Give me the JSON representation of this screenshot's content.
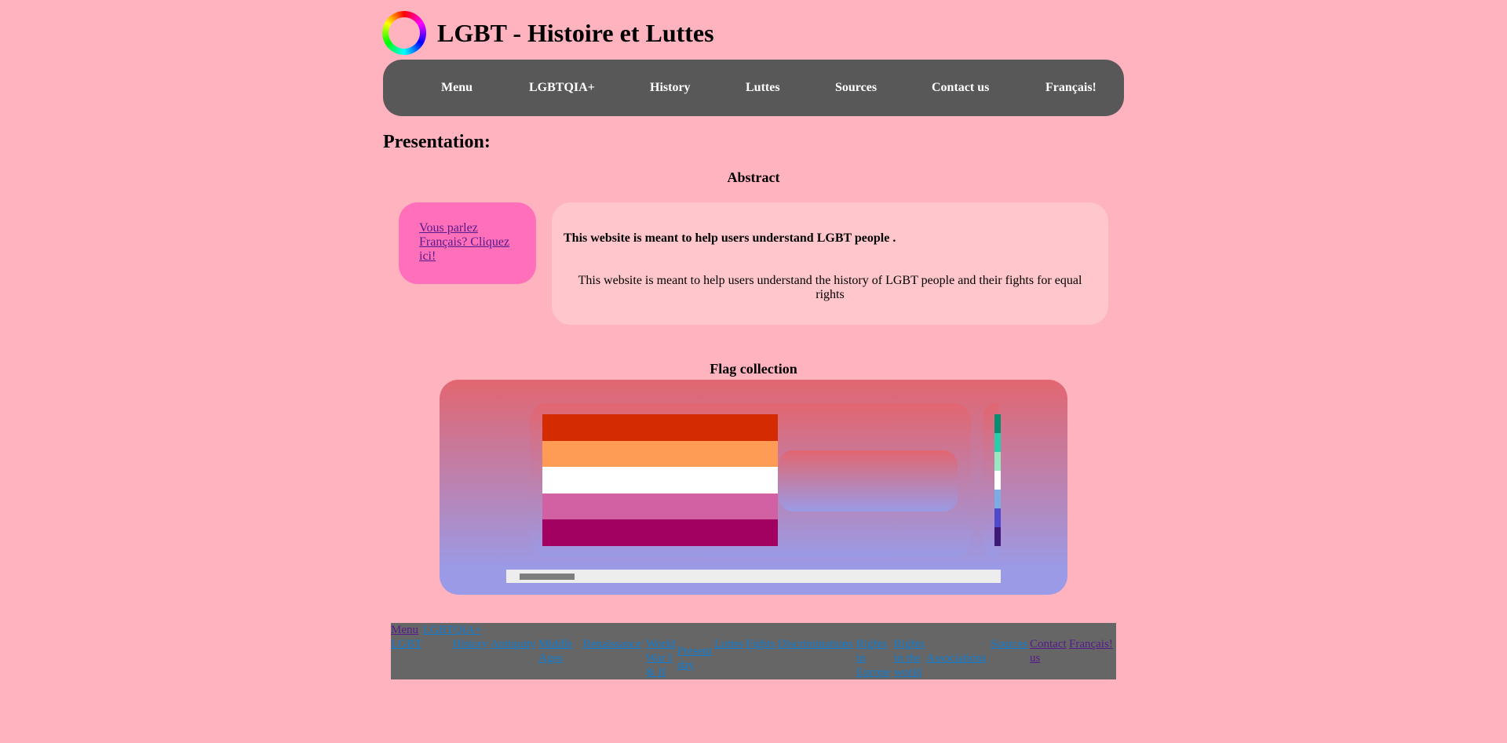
{
  "header": {
    "title": "LGBT - Histoire et Luttes",
    "logo_icon": "rainbow-ring-icon"
  },
  "nav": [
    "Menu",
    "LGBTQIA+",
    "History",
    "Luttes",
    "Sources",
    "Contact us",
    "Français!"
  ],
  "main": {
    "section_title": "Presentation:",
    "abstract_title": "Abstract",
    "french_link": "Vous parlez Français? Cliquez ici!",
    "abstract_bold": "This website is meant to help users understand LGBT people .",
    "abstract_text": "This website is meant to help users understand the history of LGBT people and their fights for equal rights",
    "flags_title": "Flag collection",
    "flag1_colors": [
      "#d42c00",
      "#fe9b55",
      "#ffffff",
      "#d161a2",
      "#a20161"
    ],
    "flag2_colors": [
      "#078d70",
      "#26ceaa",
      "#98e8c1",
      "#ffffff",
      "#7bade2",
      "#5049cc",
      "#3d1a78"
    ],
    "carousel_scroll_fraction": 0.05
  },
  "footer": {
    "links": [
      "Menu",
      "LGBT",
      "LGBTQIA+",
      "History",
      "Antiquity",
      "Middle Ages",
      "Renaissance",
      "World War I & II",
      "Present day",
      "Luttes",
      "Fights",
      "Discriminations",
      "Rights in Europe",
      "Rights in the world",
      "Associations",
      "Sources",
      "Contact us",
      "Français!"
    ]
  },
  "colors": {
    "background": "#ffb3bf",
    "nav_bg": "#585858",
    "french_box": "#ff6fba",
    "abstract_box": "#ffc6cc",
    "footer_bg": "#666666",
    "link": "#0f7bd1",
    "visited_link": "#551a8b"
  }
}
